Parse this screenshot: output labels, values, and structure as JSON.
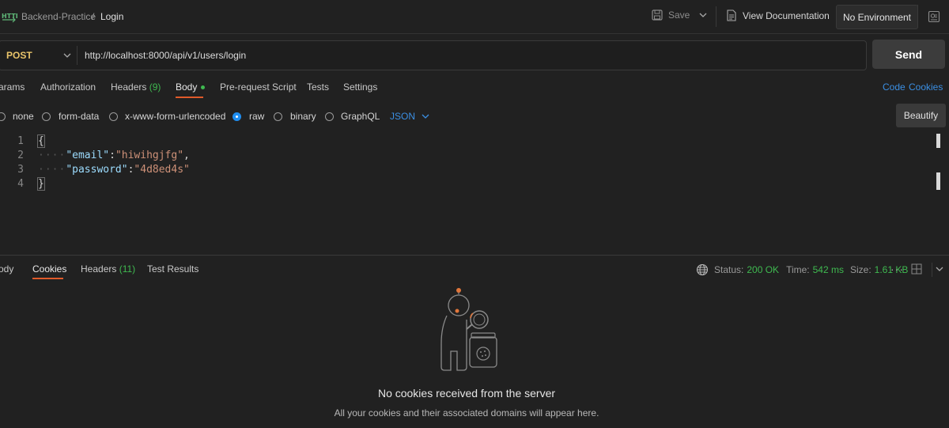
{
  "header": {
    "app_icon": "http-icon",
    "collection": "Backend-Practice",
    "separator": "/",
    "request_name": "Login",
    "save_label": "Save",
    "view_docs_label": "View Documentation",
    "environment": "No Environment"
  },
  "request": {
    "method": "POST",
    "url": "http://localhost:8000/api/v1/users/login",
    "send_label": "Send"
  },
  "request_tabs": [
    {
      "label": "arams"
    },
    {
      "label": "Authorization"
    },
    {
      "label": "Headers",
      "count": "(9)"
    },
    {
      "label": "Body"
    },
    {
      "label": "Pre-request Script"
    },
    {
      "label": "Tests"
    },
    {
      "label": "Settings"
    }
  ],
  "right_links": {
    "code": "Code",
    "cookies": "Cookies"
  },
  "body_types": [
    {
      "label": "none",
      "selected": false
    },
    {
      "label": "form-data",
      "selected": false
    },
    {
      "label": "x-www-form-urlencoded",
      "selected": false
    },
    {
      "label": "raw",
      "selected": true
    },
    {
      "label": "binary",
      "selected": false
    },
    {
      "label": "GraphQL",
      "selected": false
    }
  ],
  "format": "JSON",
  "beautify_label": "Beautify",
  "editor": {
    "line_numbers": [
      "1",
      "2",
      "3",
      "4"
    ],
    "open_brace": "{",
    "close_brace": "}",
    "email_key": "\"email\"",
    "email_value": "\"hiwihgjfg\"",
    "password_key": "\"password\"",
    "password_value": "\"4d8ed4s\""
  },
  "response_tabs": [
    {
      "label": "ody"
    },
    {
      "label": "Cookies"
    },
    {
      "label": "Headers",
      "count": "(11)"
    },
    {
      "label": "Test Results"
    }
  ],
  "response_status": {
    "status_label": "Status:",
    "status_value": "200 OK",
    "time_label": "Time:",
    "time_value": "542 ms",
    "size_label": "Size:",
    "size_value": "1.61 KB"
  },
  "empty_state": {
    "title": "No cookies received from the server",
    "subtitle": "All your cookies and their associated domains will appear here."
  },
  "colors": {
    "accent_blue": "#1f8ef1",
    "success_green": "#3fb950",
    "method_yellow": "#e9c46a"
  }
}
